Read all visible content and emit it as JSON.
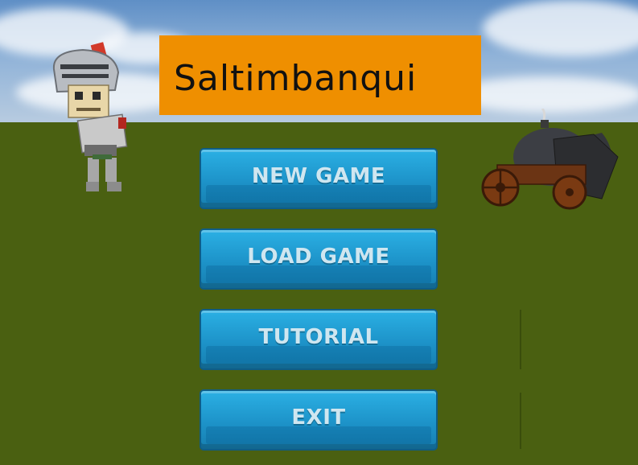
{
  "game": {
    "logo_text": "Saltimbanqui"
  },
  "menu": {
    "new_game": "NEW GAME",
    "load_game": "LOAD GAME",
    "tutorial": "TUTORIAL",
    "exit": "EXIT"
  },
  "colors": {
    "logo_background": "#ef8f00",
    "button_blue": "#1d93c9",
    "ground_green": "#4a6011"
  },
  "icons": {
    "knight": "knight-character-icon",
    "cannon": "cannon-icon"
  }
}
